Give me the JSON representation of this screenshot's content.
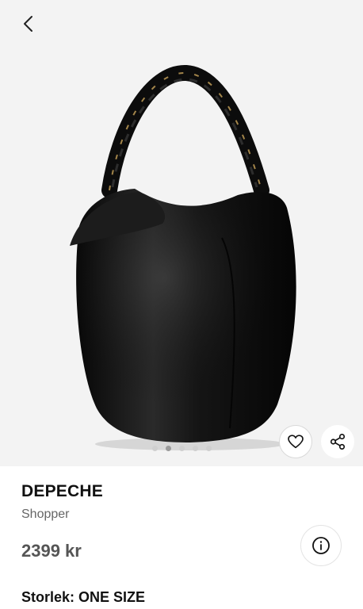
{
  "product": {
    "brand": "DEPECHE",
    "type": "Shopper",
    "price": "2399 kr",
    "size_label": "Storlek: ONE SIZE"
  },
  "gallery": {
    "image_count": 5,
    "active_index": 1
  },
  "icons": {
    "back": "chevron-left-icon",
    "favorite": "heart-icon",
    "share": "share-icon",
    "info": "info-icon"
  },
  "colors": {
    "image_background": "#f3f3f3",
    "bag": "#111111",
    "price_text": "#555555"
  }
}
